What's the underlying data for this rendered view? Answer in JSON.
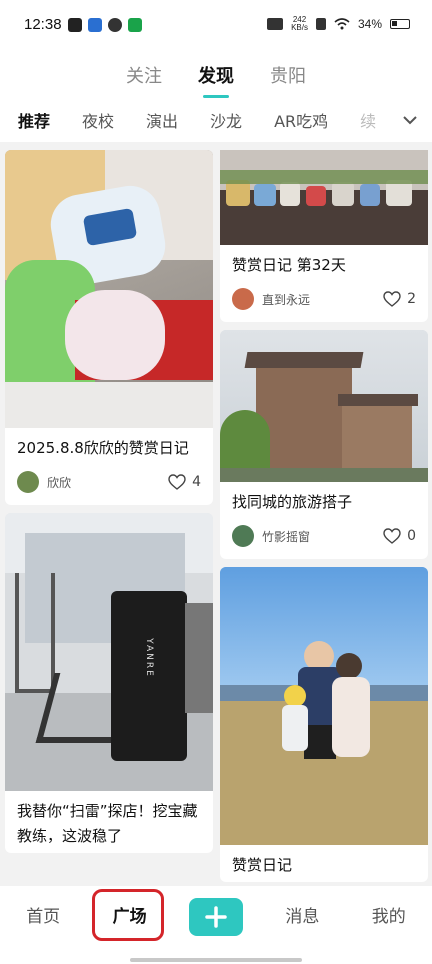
{
  "status": {
    "time": "12:38",
    "speed_value": "242",
    "speed_unit": "KB/s",
    "battery": "34%"
  },
  "top_tabs": [
    {
      "label": "关注"
    },
    {
      "label": "发现"
    },
    {
      "label": "贵阳"
    }
  ],
  "categories": [
    {
      "label": "推荐"
    },
    {
      "label": "夜校"
    },
    {
      "label": "演出"
    },
    {
      "label": "沙龙"
    },
    {
      "label": "AR吃鸡"
    },
    {
      "label": "续"
    }
  ],
  "feed": {
    "left": [
      {
        "title": "2025.8.8欣欣的赞赏日记",
        "author": "欣欣",
        "likes": "4"
      },
      {
        "title": "我替你“扫雷”探店！挖宝藏教练，这波稳了",
        "author": "",
        "likes": ""
      }
    ],
    "right": [
      {
        "title": "赞赏日记 第32天",
        "author": "直到永远",
        "likes": "2"
      },
      {
        "title": "找同城的旅游搭子",
        "author": "竹影摇窗",
        "likes": "0"
      },
      {
        "title": "赞赏日记",
        "author": "",
        "likes": ""
      }
    ],
    "equipment_text": "YANRE"
  },
  "bottom_nav": [
    {
      "label": "首页"
    },
    {
      "label": "广场"
    },
    {
      "label": ""
    },
    {
      "label": "消息"
    },
    {
      "label": "我的"
    }
  ],
  "colors": {
    "accent": "#2ec7c0",
    "highlight": "#d4252a"
  }
}
